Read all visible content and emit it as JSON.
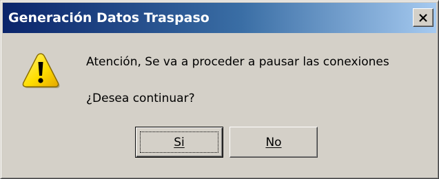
{
  "window": {
    "title": "Generación Datos Traspaso",
    "close_glyph": "×"
  },
  "dialog": {
    "icon": "warning-icon",
    "message_line1": "Atención, Se va a proceder a pausar las conexiones",
    "message_line2": "¿Desea continuar?"
  },
  "buttons": {
    "yes_label": "Si",
    "no_label": "No"
  },
  "colors": {
    "titlebar_start": "#0a246a",
    "titlebar_end": "#a6caf0",
    "dialog_bg": "#d4d0c8",
    "warning_yellow": "#ffde00"
  }
}
